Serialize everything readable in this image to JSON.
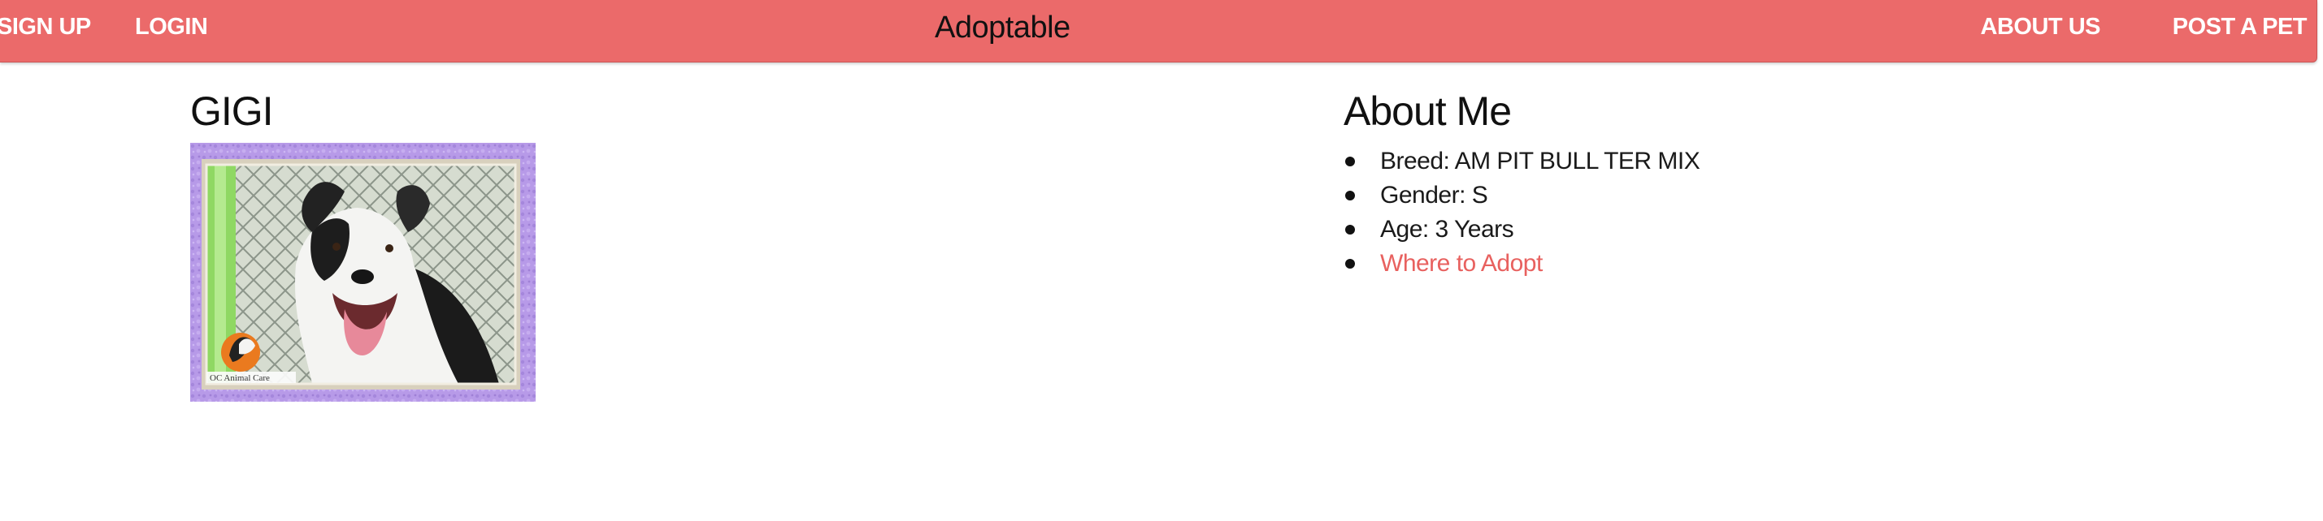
{
  "nav": {
    "signup_label": "SIGN UP",
    "login_label": "LOGIN",
    "brand": "Adoptable",
    "about_label": "ABOUT US",
    "post_label": "POST A PET",
    "bar_color": "#eb6a6a"
  },
  "pet": {
    "name": "GIGI",
    "photo_logo_text": "OC Animal Care"
  },
  "about": {
    "title": "About Me",
    "breed": "Breed: AM PIT BULL TER MIX",
    "gender": "Gender: S",
    "age": "Age: 3 Years",
    "adopt_link": "Where to Adopt",
    "link_color": "#e8615f"
  }
}
